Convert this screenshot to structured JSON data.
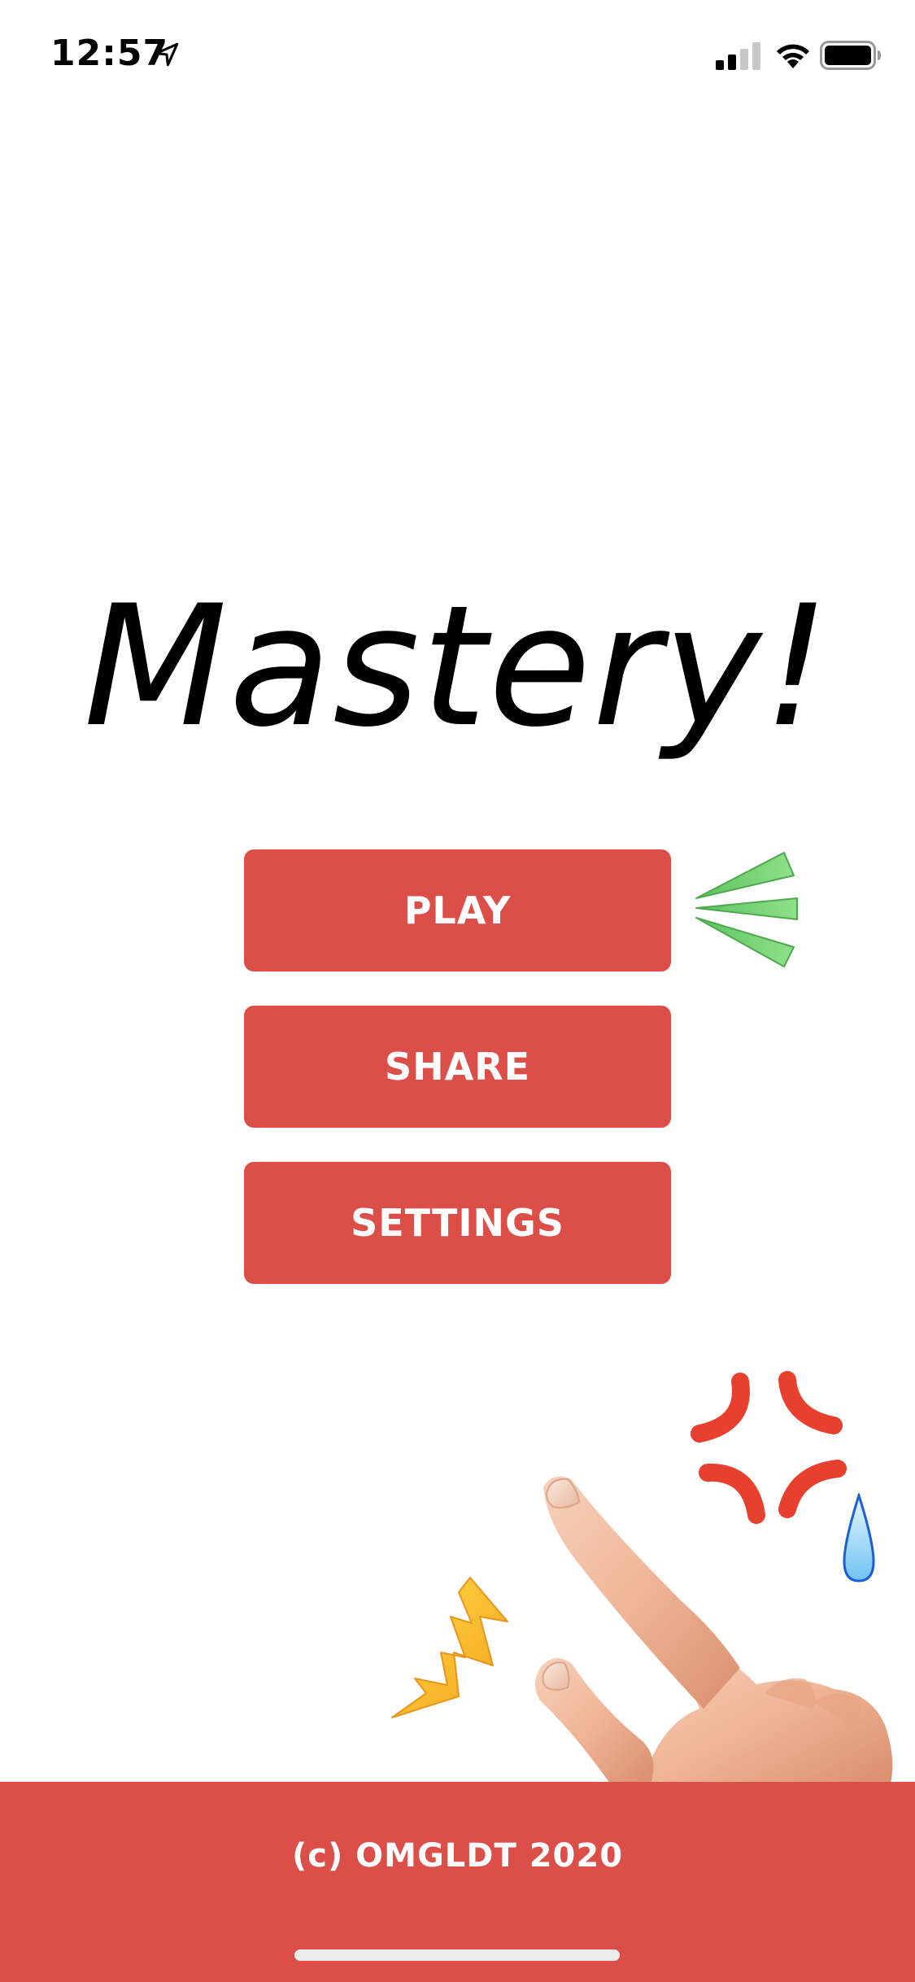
{
  "status_bar": {
    "time": "12:57",
    "icons": [
      "location-arrow-icon",
      "cellular-signal-icon",
      "wifi-icon",
      "battery-icon"
    ]
  },
  "main": {
    "title": "Mastery!",
    "buttons": {
      "play": "PLAY",
      "share": "SHARE",
      "settings": "SETTINGS"
    }
  },
  "decorations": [
    "green-lines-icon",
    "anger-symbol-icon",
    "sweat-droplet-icon",
    "lightning-spark-icon",
    "pointing-hand-image"
  ],
  "footer": {
    "copyright": "(c) OMGLDT 2020"
  },
  "colors": {
    "accent": "#dc4f49",
    "background": "#ffffff",
    "text": "#000000"
  }
}
